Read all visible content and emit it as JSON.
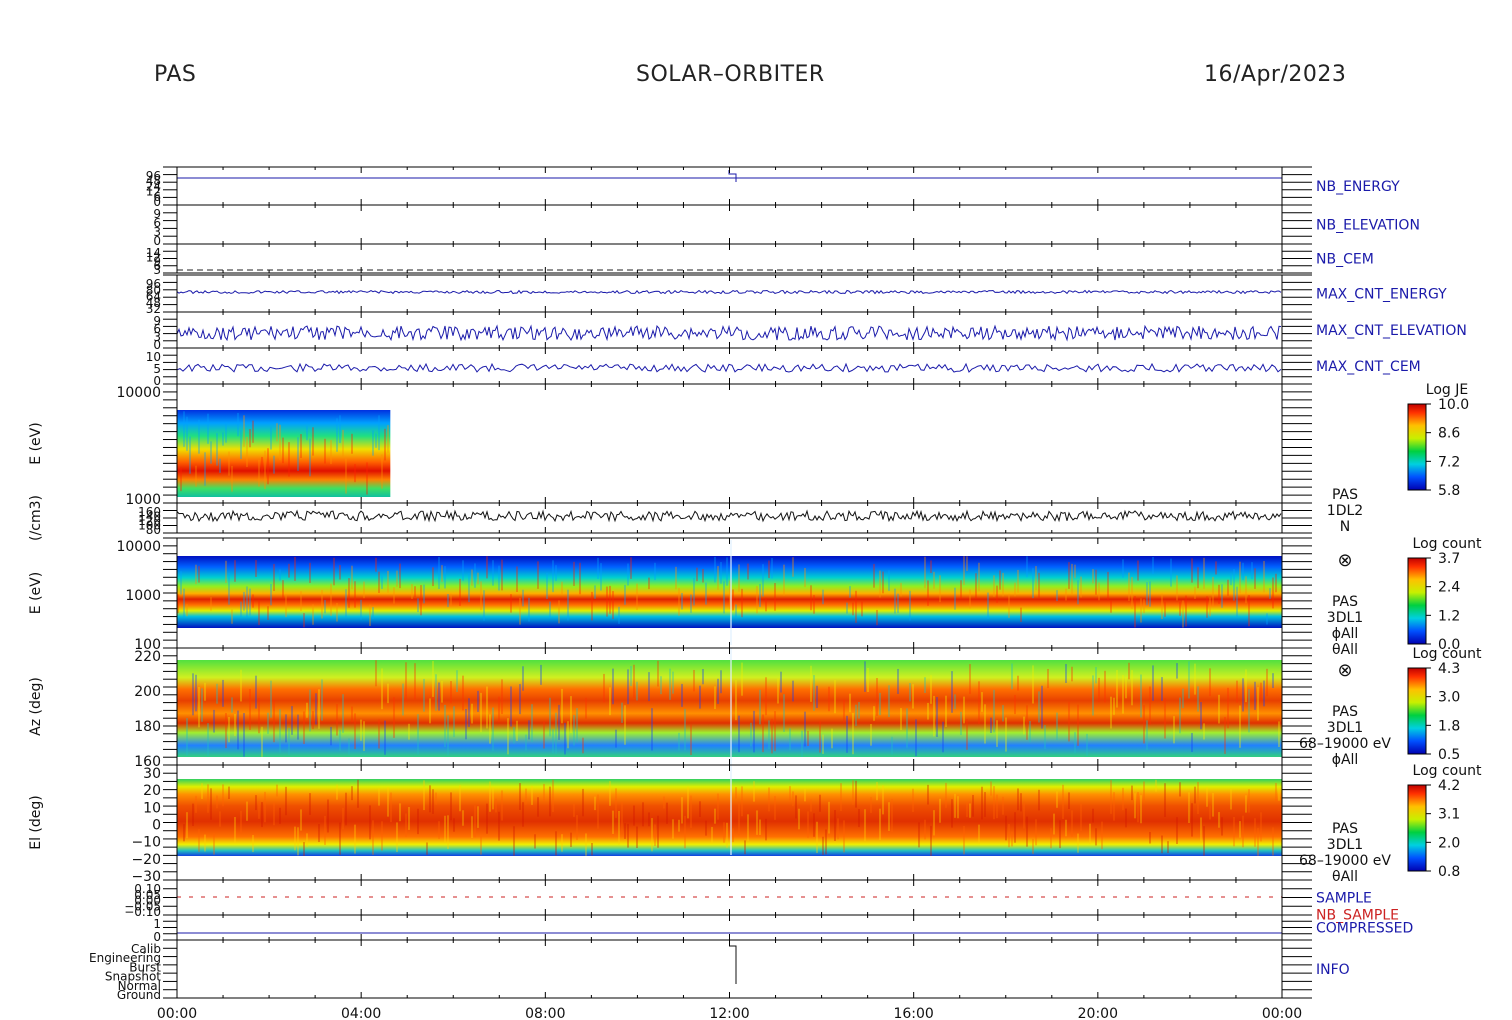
{
  "header": {
    "instrument": "PAS",
    "mission": "SOLAR–ORBITER",
    "date": "16/Apr/2023"
  },
  "chart_data": {
    "type": "line",
    "title": "",
    "x_ticks": [
      "00:00",
      "04:00",
      "08:00",
      "12:00",
      "16:00",
      "20:00",
      "00:00"
    ],
    "panels": [
      {
        "label": "NB_ENERGY",
        "color": "#1a1aaa",
        "kind": "line",
        "y_ticks": [
          "96",
          "48",
          "24",
          "12",
          "6",
          "0"
        ]
      },
      {
        "label": "NB_ELEVATION",
        "color": "#1a1aaa",
        "kind": "line",
        "y_ticks": [
          "9",
          "6",
          "3",
          "0"
        ]
      },
      {
        "label": "NB_CEM",
        "color": "#1a1aaa",
        "kind": "line",
        "y_ticks": [
          "14",
          "12",
          "9",
          "6",
          "3"
        ]
      },
      {
        "label": "MAX_CNT_ENERGY",
        "color": "#1a1aaa",
        "kind": "line",
        "y_ticks": [
          "96",
          "80",
          "64",
          "48",
          "32"
        ]
      },
      {
        "label": "MAX_CNT_ELEVATION",
        "color": "#1a1aaa",
        "kind": "line",
        "y_ticks": [
          "9",
          "6",
          "3",
          "0"
        ]
      },
      {
        "label": "MAX_CNT_CEM",
        "color": "#1a1aaa",
        "kind": "line",
        "y_ticks": [
          "10",
          "5",
          "0"
        ]
      },
      {
        "label": "E (eV)",
        "kind": "spectrogram",
        "y_ticks": [
          "10000",
          "1000"
        ],
        "colorbar": {
          "title": "Log JE",
          "ticks": [
            "10.0",
            "8.6",
            "7.2",
            "5.8"
          ]
        },
        "data_end": "04:38"
      },
      {
        "label": "(/cm3)",
        "kind": "line",
        "color": "#111111",
        "side_labels": [
          "PAS",
          "1DL2",
          "N"
        ],
        "y_ticks": [
          "160",
          "140",
          "120",
          "100",
          "80"
        ]
      },
      {
        "label": "E (eV)",
        "kind": "spectrogram",
        "y_ticks": [
          "10000",
          "1000",
          "100"
        ],
        "side_labels": [
          "PAS",
          "3DL1",
          "ϕAll",
          "θAll"
        ],
        "side_icon": "⊗",
        "colorbar": {
          "title": "Log count",
          "ticks": [
            "3.7",
            "2.4",
            "1.2",
            "0.0"
          ]
        }
      },
      {
        "label": "Az (deg)",
        "kind": "spectrogram",
        "y_ticks": [
          "220",
          "200",
          "180",
          "160"
        ],
        "side_labels": [
          "PAS",
          "3DL1",
          "68–19000 eV",
          "ϕAll"
        ],
        "side_icon": "⊗",
        "colorbar": {
          "title": "Log count",
          "ticks": [
            "4.3",
            "3.0",
            "1.8",
            "0.5"
          ]
        }
      },
      {
        "label": "El (deg)",
        "kind": "spectrogram",
        "y_ticks": [
          "30",
          "20",
          "10",
          "0",
          "−10",
          "−20",
          "−30"
        ],
        "side_labels": [
          "PAS",
          "3DL1",
          "68–19000 eV",
          "θAll"
        ],
        "colorbar": {
          "title": "Log count",
          "ticks": [
            "4.2",
            "3.1",
            "2.0",
            "0.8"
          ]
        }
      },
      {
        "label": "SAMPLE",
        "label2": "NB_SAMPLE",
        "color": "#1a1aaa",
        "color2": "#cc2222",
        "kind": "line",
        "y_ticks": [
          "0.10",
          "0.05",
          "0.00",
          "−0.05",
          "−0.10"
        ]
      },
      {
        "label": "COMPRESSED",
        "color": "#1a1aaa",
        "kind": "line",
        "y_ticks": [
          "1",
          "0"
        ]
      },
      {
        "label": "INFO",
        "color": "#1a1aaa",
        "kind": "line",
        "y_ticks": [
          "Calib",
          "Engineering",
          "Burst",
          "Snapshot",
          "Normal",
          "Ground"
        ]
      }
    ]
  }
}
